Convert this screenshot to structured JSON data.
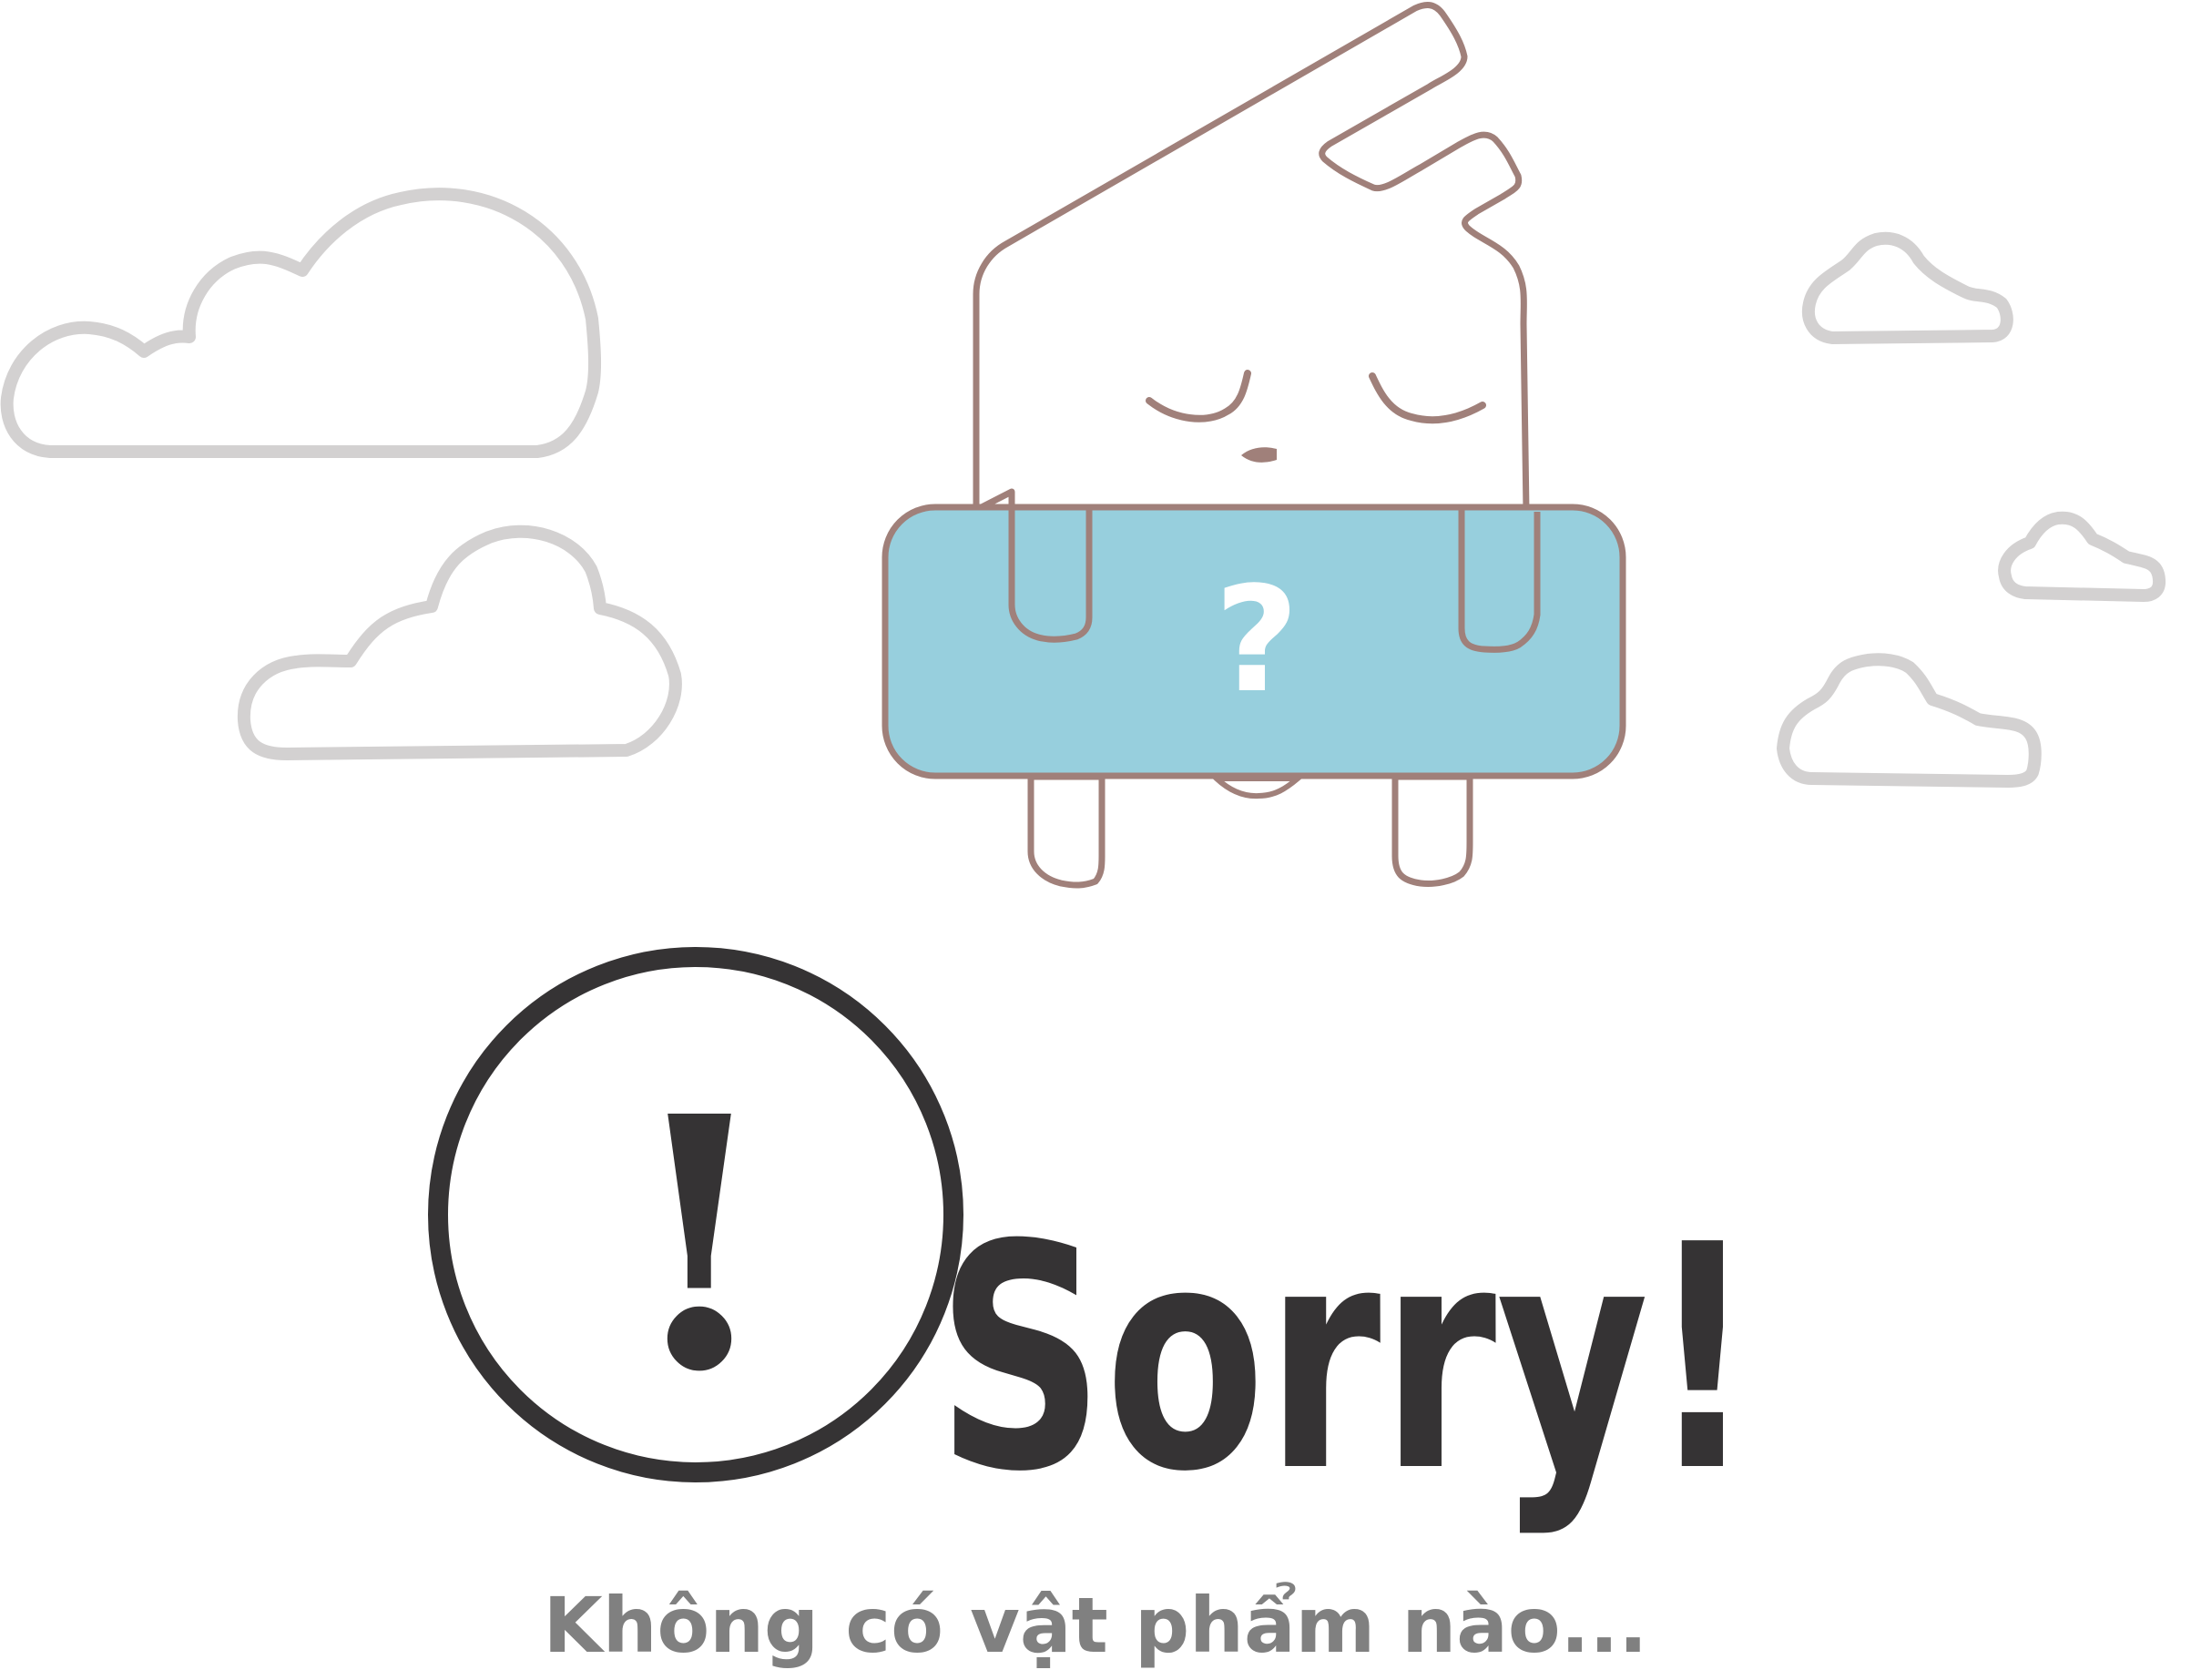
{
  "empty_state": {
    "exclamation": "!",
    "sorry_text": "Sorry!",
    "message": "Không có vật phẩm nào...",
    "sign_symbol": "?"
  },
  "colors": {
    "background": "#ffffff",
    "cloud_outline": "#d3d1d1",
    "mascot_outline": "#a0807a",
    "sign_fill": "#97cfdd",
    "text_dark": "#353334",
    "text_gray": "#808080"
  },
  "icons": [
    "cloud-icon",
    "mascot-icon",
    "alert-circle-icon"
  ]
}
